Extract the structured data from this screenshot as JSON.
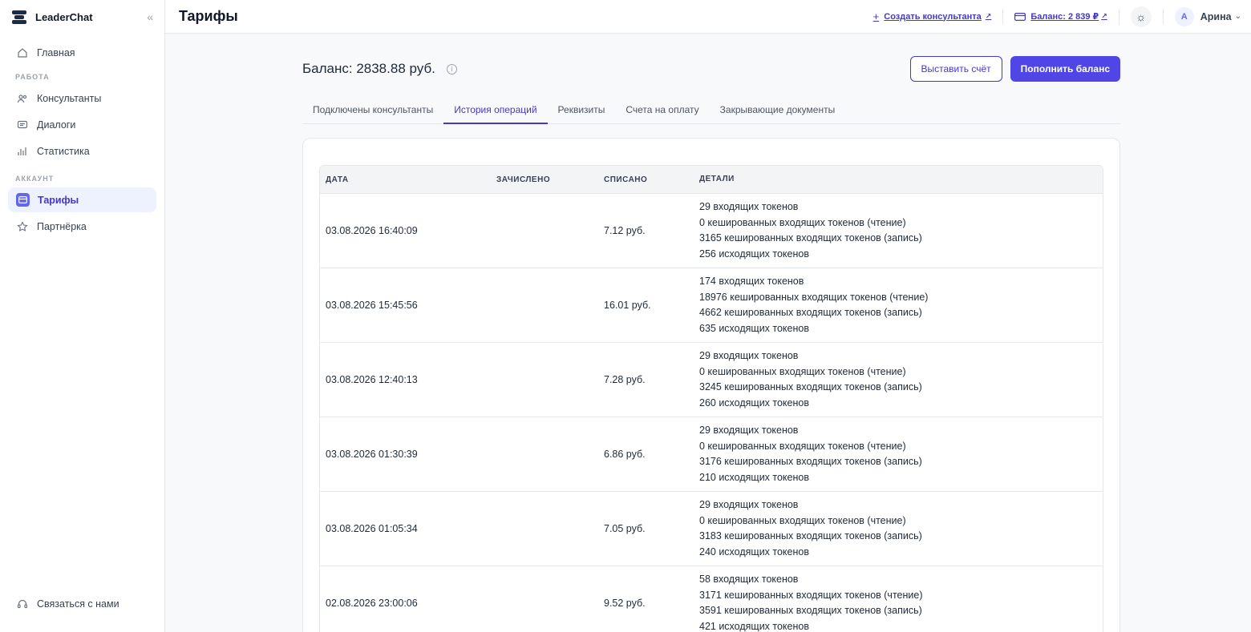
{
  "brand": {
    "name": "LeaderChat"
  },
  "sidebar": {
    "items_main": [
      {
        "label": "Главная"
      }
    ],
    "section_work": "РАБОТА",
    "items_work": [
      {
        "label": "Консультанты"
      },
      {
        "label": "Диалоги"
      },
      {
        "label": "Статистика"
      }
    ],
    "section_account": "АККАУНТ",
    "items_account": [
      {
        "label": "Тарифы"
      },
      {
        "label": "Партнёрка"
      }
    ],
    "footer_label": "Связаться с нами"
  },
  "header": {
    "title": "Тарифы",
    "create_link": "Создать консультанта",
    "balance_link": "Баланс: 2 839 ₽",
    "user_initial": "А",
    "user_name": "Арина"
  },
  "main": {
    "balance_text": "Баланс: 2838.88 руб.",
    "invoice_button": "Выставить счёт",
    "topup_button": "Пополнить баланс",
    "tabs": [
      {
        "label": "Подключены консультанты"
      },
      {
        "label": "История операций"
      },
      {
        "label": "Реквизиты"
      },
      {
        "label": "Счета на оплату"
      },
      {
        "label": "Закрывающие документы"
      }
    ]
  },
  "table": {
    "headers": {
      "date": "ДАТА",
      "credit": "ЗАЧИСЛЕНО",
      "debit": "СПИСАНО",
      "details": "ДЕТАЛИ"
    },
    "rows": [
      {
        "date": "03.08.2026 16:40:09",
        "credit": "",
        "debit": "7.12 руб.",
        "details": [
          "29 входящих токенов",
          "0 кешированных входящих токенов (чтение)",
          "3165 кешированных входящих токенов (запись)",
          "256 исходящих токенов"
        ]
      },
      {
        "date": "03.08.2026 15:45:56",
        "credit": "",
        "debit": "16.01 руб.",
        "details": [
          "174 входящих токенов",
          "18976 кешированных входящих токенов (чтение)",
          "4662 кешированных входящих токенов (запись)",
          "635 исходящих токенов"
        ]
      },
      {
        "date": "03.08.2026 12:40:13",
        "credit": "",
        "debit": "7.28 руб.",
        "details": [
          "29 входящих токенов",
          "0 кешированных входящих токенов (чтение)",
          "3245 кешированных входящих токенов (запись)",
          "260 исходящих токенов"
        ]
      },
      {
        "date": "03.08.2026 01:30:39",
        "credit": "",
        "debit": "6.86 руб.",
        "details": [
          "29 входящих токенов",
          "0 кешированных входящих токенов (чтение)",
          "3176 кешированных входящих токенов (запись)",
          "210 исходящих токенов"
        ]
      },
      {
        "date": "03.08.2026 01:05:34",
        "credit": "",
        "debit": "7.05 руб.",
        "details": [
          "29 входящих токенов",
          "0 кешированных входящих токенов (чтение)",
          "3183 кешированных входящих токенов (запись)",
          "240 исходящих токенов"
        ]
      },
      {
        "date": "02.08.2026 23:00:06",
        "credit": "",
        "debit": "9.52 руб.",
        "details": [
          "58 входящих токенов",
          "3171 кешированных входящих токенов (чтение)",
          "3591 кешированных входящих токенов (запись)",
          "421 исходящих токенов"
        ]
      }
    ]
  },
  "colors": {
    "accent": "#4f46e5",
    "accent_dark": "#4338ca",
    "active_bg": "#eef2ff"
  },
  "icons": [
    "home-icon",
    "users-icon",
    "chat-icon",
    "stats-icon",
    "card-icon",
    "star-icon",
    "headset-icon",
    "sun-icon",
    "info-icon",
    "plus-icon",
    "external-link-icon",
    "chevron-down-icon",
    "collapse-icon"
  ]
}
